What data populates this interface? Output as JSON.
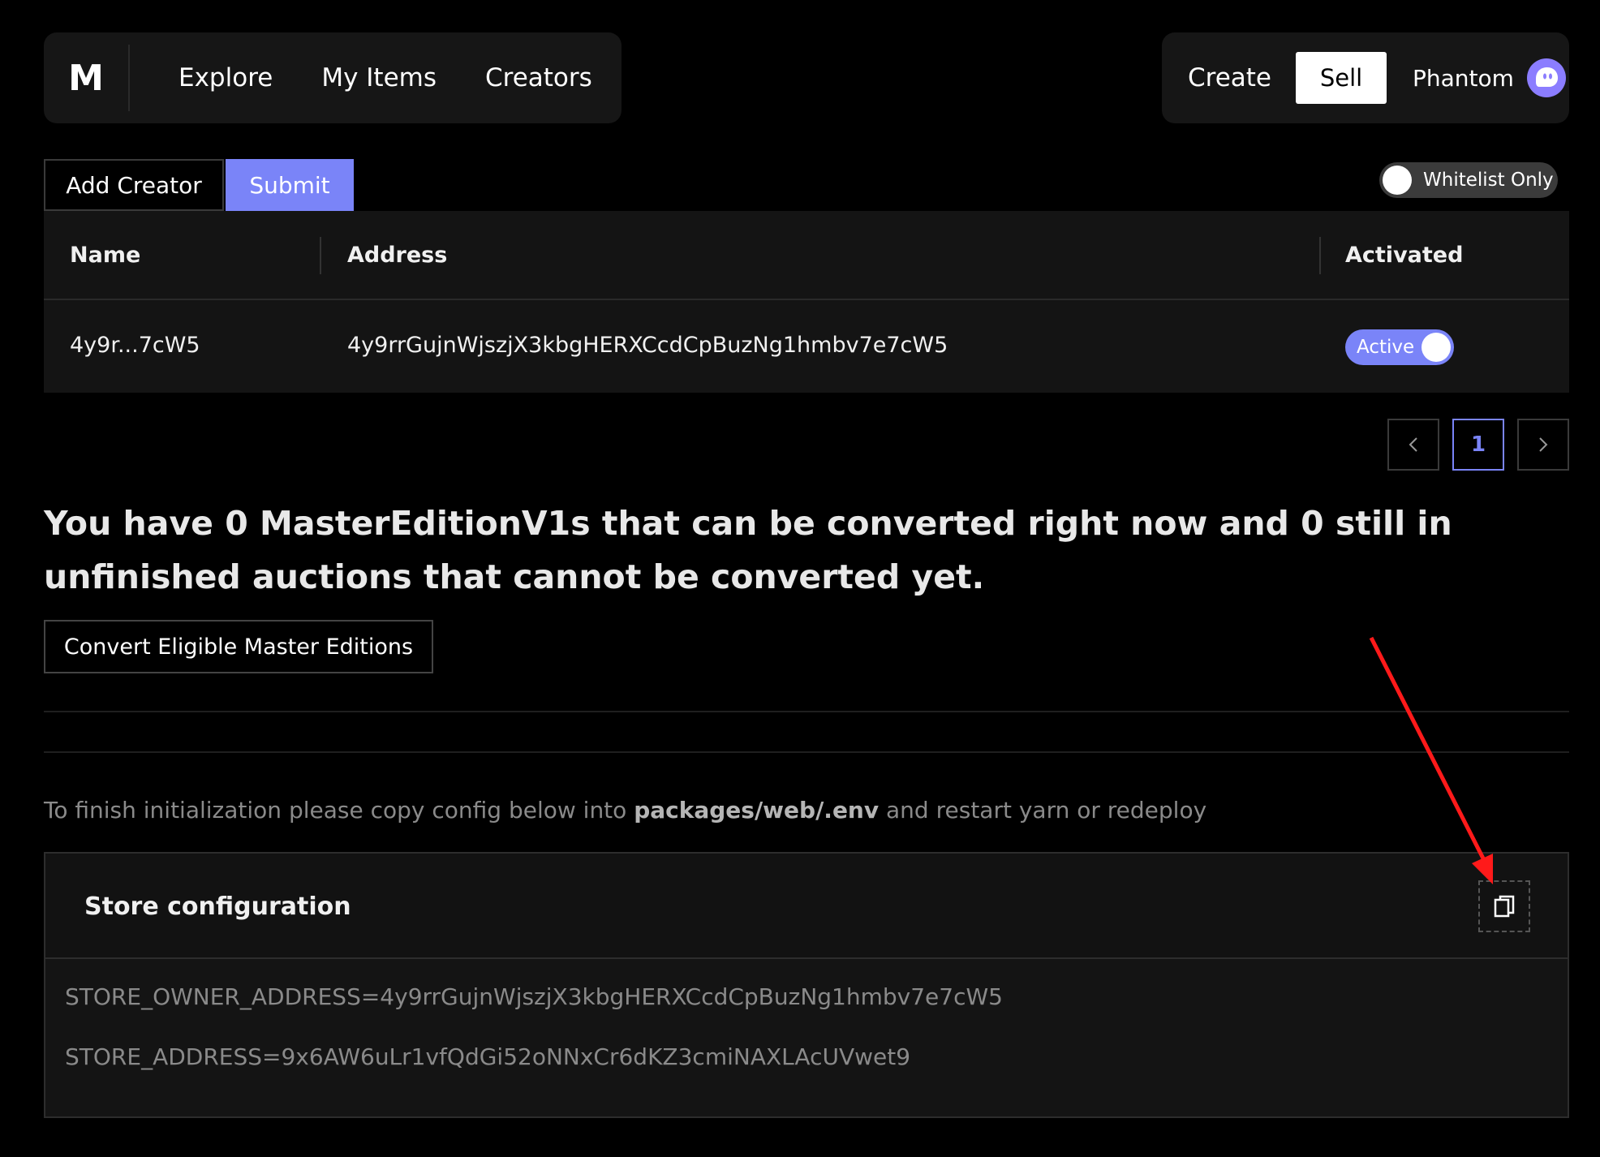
{
  "nav": {
    "logo": "M",
    "links": [
      "Explore",
      "My Items",
      "Creators"
    ],
    "create_label": "Create",
    "sell_label": "Sell",
    "wallet_label": "Phantom"
  },
  "toolbar": {
    "add_creator_label": "Add Creator",
    "submit_label": "Submit",
    "whitelist_label": "Whitelist Only"
  },
  "table": {
    "headers": [
      "Name",
      "Address",
      "Activated"
    ],
    "rows": [
      {
        "name": "4y9r...7cW5",
        "address": "4y9rrGujnWjszjX3kbgHERXCcdCpBuzNg1hmbv7e7cW5",
        "status": "Active"
      }
    ]
  },
  "pagination": {
    "prev": "<",
    "current": "1",
    "next": ">"
  },
  "headline": "You have 0 MasterEditionV1s that can be converted right now and 0 still in unfinished auctions that cannot be converted yet.",
  "convert_label": "Convert Eligible Master Editions",
  "info": {
    "prefix": "To finish initialization please copy config below into ",
    "path": "packages/web/.env",
    "suffix": " and restart yarn or redeploy"
  },
  "store_config": {
    "title": "Store configuration",
    "lines": [
      "STORE_OWNER_ADDRESS=4y9rrGujnWjszjX3kbgHERXCcdCpBuzNg1hmbv7e7cW5",
      "STORE_ADDRESS=9x6AW6uLr1vfQdGi52oNNxCr6dKZ3cmiNAXLAcUVwet9"
    ]
  },
  "colors": {
    "accent": "#7a84f8",
    "annotation_arrow": "#ff1a1a"
  }
}
